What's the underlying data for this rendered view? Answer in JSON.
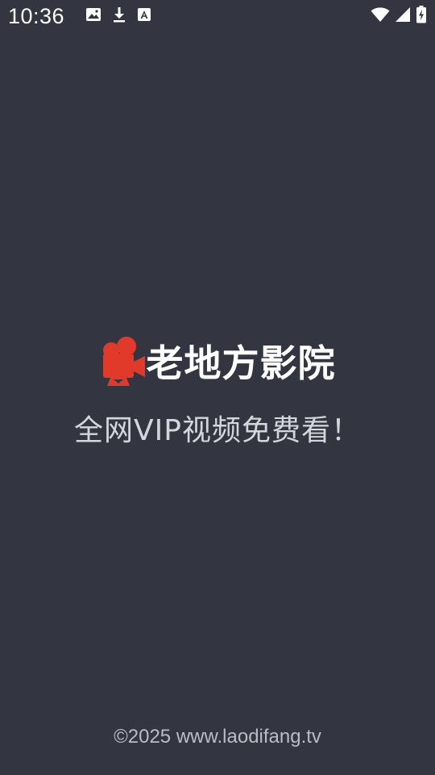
{
  "status_bar": {
    "time": "10:36",
    "left_icons": [
      "image-icon",
      "download-icon",
      "keyboard-a-icon"
    ],
    "right_icons": [
      "wifi-icon",
      "signal-icon",
      "battery-charging-icon"
    ]
  },
  "splash": {
    "logo_icon": "movie-camera-icon",
    "brand_title": "老地方影院",
    "tagline": "全网VIP视频免费看！"
  },
  "footer": {
    "copyright": "©2025 www.laodifang.tv"
  },
  "colors": {
    "background": "#333640",
    "brand_red": "#e23a2a",
    "title_text": "#ffffff",
    "tagline_text": "#d4d6dc",
    "footer_text": "#b9bcc4"
  }
}
